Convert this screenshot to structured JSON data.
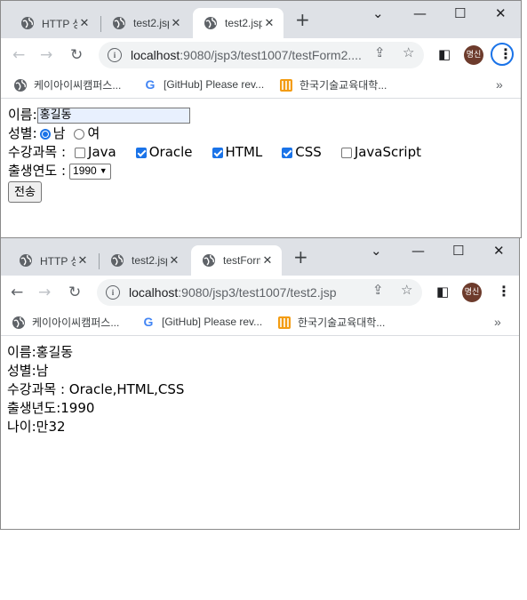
{
  "window1": {
    "tabs": [
      {
        "title": "HTTP 상",
        "active": false
      },
      {
        "title": "test2.jsp",
        "active": false
      },
      {
        "title": "test2.jsp",
        "active": true
      }
    ],
    "new_tab": "+",
    "controls": {
      "dropdown": "⌄",
      "minimize": "—",
      "maximize": "☐",
      "close": "✕"
    },
    "url_host": "localhost",
    "url_path": ":9080/jsp3/test1007/testForm2....",
    "profile": "명신",
    "bookmarks": [
      "케이아이씨캠퍼스...",
      "[GitHub] Please rev...",
      "한국기술교육대학..."
    ],
    "bookmarks_more": "»",
    "form": {
      "name_label": "이름:",
      "name_value": "홍길동",
      "gender_label": "성별:",
      "gender_male": "남",
      "gender_female": "여",
      "gender_selected": "남",
      "courses_label": "수강과목 :",
      "courses": [
        {
          "label": "Java",
          "checked": false
        },
        {
          "label": "Oracle",
          "checked": true
        },
        {
          "label": "HTML",
          "checked": true
        },
        {
          "label": "CSS",
          "checked": true
        },
        {
          "label": "JavaScript",
          "checked": false
        }
      ],
      "birth_label": "출생연도 :",
      "birth_value": "1990",
      "submit_label": "전송"
    }
  },
  "window2": {
    "tabs": [
      {
        "title": "HTTP 상",
        "active": false
      },
      {
        "title": "test2.jsp",
        "active": false
      },
      {
        "title": "testForm",
        "active": true
      }
    ],
    "new_tab": "+",
    "controls": {
      "dropdown": "⌄",
      "minimize": "—",
      "maximize": "☐",
      "close": "✕"
    },
    "url_host": "localhost",
    "url_path": ":9080/jsp3/test1007/test2.jsp",
    "profile": "명신",
    "bookmarks": [
      "케이아이씨캠퍼스...",
      "[GitHub] Please rev...",
      "한국기술교육대학..."
    ],
    "bookmarks_more": "»",
    "result": [
      "이름:홍길동",
      "성별:남",
      "수강과목 : Oracle,HTML,CSS",
      "출생년도:1990",
      "나이:만32"
    ]
  },
  "colors": {
    "tabstrip": "#dee1e6",
    "accent": "#1a73e8",
    "avatar": "#6d3b2c",
    "autofill": "#e8f0fe"
  }
}
